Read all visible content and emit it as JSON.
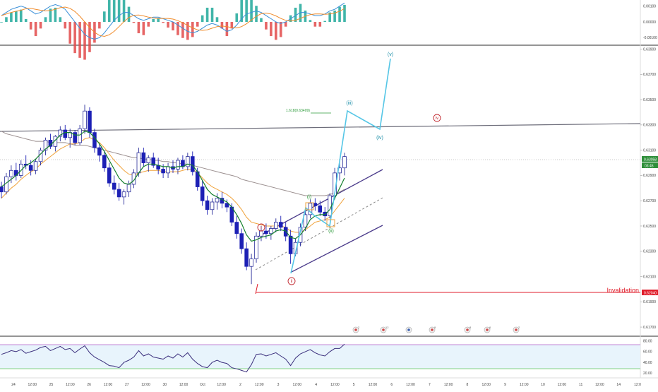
{
  "colors": {
    "up": "#2a2e9a",
    "down": "#1d20b5",
    "ema_fast": "#16802e",
    "ema_slow": "#f0a33c",
    "sma_long": "#9b8f8f",
    "wave": "#55c6e6",
    "channel": "#4a3a8a",
    "invalidation": "#e01e2b",
    "fib_label": "#2c9a3a",
    "wave_red": "#c0262d",
    "wave_green": "#2c9a3a",
    "wave_teal": "#1d8fa8",
    "rsi": "#3b2f7d",
    "rsi_band_fill": "#e8f4fc",
    "rsi_upper": "#b05cc6",
    "rsi_lower": "#5cc65c",
    "macd": "#3a8fd8",
    "macd_signal": "#f08c2c",
    "hist_pos": "#20a89a",
    "hist_neg": "#e24a4a",
    "axis_text": "#444444"
  },
  "price_axis": {
    "ticks": [
      "0.63900",
      "0.63700",
      "0.63500",
      "0.63300",
      "0.63100",
      "0.62900",
      "0.62700",
      "0.62500",
      "0.62300",
      "0.62100",
      "0.61900",
      "0.61700"
    ],
    "last_price_label": "0.63058",
    "countdown_label": "03:45",
    "invalidation_price_label": "0.62040"
  },
  "macd_axis": {
    "ticks": [
      "0.00100",
      "0.00000",
      "-0.00100"
    ]
  },
  "rsi_axis": {
    "ticks": [
      "80.00",
      "60.00",
      "40.00",
      "20.00"
    ]
  },
  "time_axis": {
    "labels": [
      "24",
      "12:00",
      "25",
      "12:00",
      "26",
      "12:00",
      "27",
      "12:00",
      "30",
      "12:00",
      "Oct",
      "12:00",
      "2",
      "12:00",
      "3",
      "12:00",
      "4",
      "12:00",
      "5",
      "12:00",
      "6",
      "12:00",
      "7",
      "12:00",
      "8",
      "12:00",
      "9",
      "12:00",
      "10",
      "12:00",
      "11",
      "12:00",
      "14",
      "12:0"
    ]
  },
  "annotations": {
    "fib_label": "1.618(0.63409)",
    "invalidation": "Invalidation",
    "wave_i": "i",
    "wave_ii": "ii",
    "wave_iv_big": "iv",
    "sub_i": "(i)",
    "sub_ii": "(ii)",
    "sub_iii": "(iii)",
    "sub_iv": "(iv)",
    "sub_v": "(v)"
  },
  "event_markers": [
    {
      "label": "2"
    },
    {
      "label": "12"
    },
    {
      "label": ""
    },
    {
      "label": "9"
    },
    {
      "label": "8"
    },
    {
      "label": "6"
    },
    {
      "label": "2"
    }
  ],
  "chart_data": {
    "type": "candlestick",
    "ylim": [
      0.6165,
      0.6392
    ],
    "ohlc": [
      [
        0.6281,
        0.6285,
        0.6272,
        0.6277
      ],
      [
        0.6277,
        0.6292,
        0.6275,
        0.6289
      ],
      [
        0.6289,
        0.6298,
        0.6284,
        0.6294
      ],
      [
        0.6294,
        0.63,
        0.6286,
        0.629
      ],
      [
        0.629,
        0.6302,
        0.6288,
        0.6299
      ],
      [
        0.6299,
        0.6306,
        0.6295,
        0.6298
      ],
      [
        0.6298,
        0.6302,
        0.629,
        0.6294
      ],
      [
        0.6294,
        0.6303,
        0.6291,
        0.6301
      ],
      [
        0.6301,
        0.6312,
        0.6298,
        0.631
      ],
      [
        0.631,
        0.632,
        0.6306,
        0.6318
      ],
      [
        0.6318,
        0.6323,
        0.6311,
        0.6313
      ],
      [
        0.6313,
        0.6322,
        0.6309,
        0.6321
      ],
      [
        0.6321,
        0.6329,
        0.6317,
        0.6326
      ],
      [
        0.6326,
        0.633,
        0.6318,
        0.632
      ],
      [
        0.632,
        0.6327,
        0.6312,
        0.6324
      ],
      [
        0.6324,
        0.6326,
        0.6314,
        0.6316
      ],
      [
        0.6316,
        0.633,
        0.6314,
        0.6327
      ],
      [
        0.6327,
        0.6346,
        0.6323,
        0.6341
      ],
      [
        0.6341,
        0.6344,
        0.632,
        0.6324
      ],
      [
        0.6324,
        0.6327,
        0.6308,
        0.6312
      ],
      [
        0.6312,
        0.6315,
        0.6301,
        0.6306
      ],
      [
        0.6306,
        0.6309,
        0.6293,
        0.6296
      ],
      [
        0.6296,
        0.63,
        0.6281,
        0.6284
      ],
      [
        0.6284,
        0.629,
        0.6275,
        0.6279
      ],
      [
        0.6279,
        0.6284,
        0.627,
        0.6273
      ],
      [
        0.6273,
        0.6279,
        0.6267,
        0.6277
      ],
      [
        0.6277,
        0.6286,
        0.6273,
        0.6283
      ],
      [
        0.6283,
        0.6295,
        0.628,
        0.6292
      ],
      [
        0.6292,
        0.6312,
        0.6289,
        0.6308
      ],
      [
        0.6308,
        0.6312,
        0.6297,
        0.63
      ],
      [
        0.63,
        0.6306,
        0.6293,
        0.6304
      ],
      [
        0.6304,
        0.6308,
        0.6296,
        0.6298
      ],
      [
        0.6298,
        0.6304,
        0.6291,
        0.6295
      ],
      [
        0.6295,
        0.6299,
        0.6288,
        0.6292
      ],
      [
        0.6292,
        0.63,
        0.6288,
        0.6297
      ],
      [
        0.6297,
        0.6302,
        0.6292,
        0.6295
      ],
      [
        0.6295,
        0.6304,
        0.6291,
        0.6302
      ],
      [
        0.6302,
        0.6306,
        0.6295,
        0.6297
      ],
      [
        0.6297,
        0.6308,
        0.6294,
        0.6305
      ],
      [
        0.6305,
        0.6309,
        0.629,
        0.6293
      ],
      [
        0.6293,
        0.6296,
        0.6278,
        0.6281
      ],
      [
        0.6281,
        0.6286,
        0.6266,
        0.627
      ],
      [
        0.627,
        0.6274,
        0.6259,
        0.6263
      ],
      [
        0.6263,
        0.6272,
        0.6259,
        0.6269
      ],
      [
        0.6269,
        0.6276,
        0.6263,
        0.6272
      ],
      [
        0.6272,
        0.6277,
        0.6264,
        0.6268
      ],
      [
        0.6268,
        0.6271,
        0.6261,
        0.6265
      ],
      [
        0.6265,
        0.6268,
        0.625,
        0.6253
      ],
      [
        0.6253,
        0.6258,
        0.624,
        0.6244
      ],
      [
        0.6244,
        0.6248,
        0.6228,
        0.6232
      ],
      [
        0.6232,
        0.6237,
        0.6215,
        0.6218
      ],
      [
        0.6218,
        0.6228,
        0.6204,
        0.6224
      ],
      [
        0.6224,
        0.6245,
        0.6221,
        0.6242
      ],
      [
        0.6242,
        0.625,
        0.6238,
        0.6246
      ],
      [
        0.6246,
        0.6252,
        0.624,
        0.6244
      ],
      [
        0.6244,
        0.625,
        0.6239,
        0.6248
      ],
      [
        0.6248,
        0.6256,
        0.6245,
        0.6253
      ],
      [
        0.6253,
        0.6258,
        0.6246,
        0.6249
      ],
      [
        0.6249,
        0.6253,
        0.6238,
        0.6242
      ],
      [
        0.6242,
        0.6247,
        0.622,
        0.6228
      ],
      [
        0.6228,
        0.624,
        0.6226,
        0.6237
      ],
      [
        0.6237,
        0.6252,
        0.6234,
        0.6249
      ],
      [
        0.6249,
        0.6262,
        0.6246,
        0.6259
      ],
      [
        0.6259,
        0.6271,
        0.6256,
        0.6268
      ],
      [
        0.6268,
        0.6272,
        0.6262,
        0.6266
      ],
      [
        0.6266,
        0.627,
        0.6258,
        0.6261
      ],
      [
        0.6261,
        0.6265,
        0.6254,
        0.6258
      ],
      [
        0.6258,
        0.6276,
        0.6256,
        0.6274
      ],
      [
        0.6274,
        0.6296,
        0.6271,
        0.6292
      ],
      [
        0.6292,
        0.63,
        0.6286,
        0.6296
      ],
      [
        0.6296,
        0.6308,
        0.629,
        0.6305
      ]
    ],
    "ema_fast": [
      0.6281,
      0.6284,
      0.6287,
      0.629,
      0.6294,
      0.6298,
      0.63,
      0.6303,
      0.6307,
      0.6311,
      0.6314,
      0.6318,
      0.6322,
      0.6324,
      0.6324,
      0.6322,
      0.6322,
      0.6325,
      0.6324,
      0.632,
      0.6315,
      0.6309,
      0.6302,
      0.6295,
      0.6288,
      0.6284,
      0.6283,
      0.6286,
      0.6292,
      0.6297,
      0.6299,
      0.6299,
      0.6298,
      0.6297,
      0.6297,
      0.6296,
      0.6297,
      0.6297,
      0.6299,
      0.6298,
      0.6293,
      0.6286,
      0.6279,
      0.6275,
      0.6273,
      0.6271,
      0.6269,
      0.6265,
      0.6259,
      0.6252,
      0.6243,
      0.6238,
      0.6239,
      0.6241,
      0.6242,
      0.6243,
      0.6246,
      0.6247,
      0.6246,
      0.6241,
      0.624,
      0.6243,
      0.6248,
      0.6255,
      0.6258,
      0.6259,
      0.6259,
      0.6263,
      0.6272,
      0.628,
      0.6288
    ],
    "ema_slow": [
      0.6272,
      0.6276,
      0.628,
      0.6283,
      0.6287,
      0.629,
      0.6293,
      0.6295,
      0.6299,
      0.6302,
      0.6305,
      0.6308,
      0.6311,
      0.6313,
      0.6315,
      0.6315,
      0.6316,
      0.6319,
      0.632,
      0.6318,
      0.6316,
      0.6312,
      0.6307,
      0.6302,
      0.6298,
      0.6294,
      0.6291,
      0.629,
      0.6292,
      0.6293,
      0.6294,
      0.6294,
      0.6294,
      0.6293,
      0.6293,
      0.6293,
      0.6293,
      0.6294,
      0.6295,
      0.6295,
      0.6292,
      0.6288,
      0.6284,
      0.6281,
      0.6279,
      0.6277,
      0.6275,
      0.6272,
      0.6268,
      0.6263,
      0.6257,
      0.6253,
      0.6252,
      0.6251,
      0.625,
      0.625,
      0.625,
      0.625,
      0.6249,
      0.6246,
      0.6245,
      0.6245,
      0.6247,
      0.625,
      0.6253,
      0.6254,
      0.6255,
      0.6257,
      0.6262,
      0.6267,
      0.6272
    ],
    "sma_long": [
      0.6325,
      0.6323,
      0.6322,
      0.6321,
      0.632,
      0.6319,
      0.6318,
      0.6317,
      0.6317,
      0.6317,
      0.6316,
      0.6316,
      0.6316,
      0.6316,
      0.6315,
      0.6314,
      0.6314,
      0.6314,
      0.6313,
      0.6312,
      0.6311,
      0.631,
      0.6309,
      0.6308,
      0.6307,
      0.6306,
      0.6305,
      0.6304,
      0.6304,
      0.6303,
      0.6303,
      0.6302,
      0.6302,
      0.6301,
      0.6301,
      0.63,
      0.63,
      0.6299,
      0.6299,
      0.6298,
      0.6297,
      0.6296,
      0.6295,
      0.6294,
      0.6293,
      0.6292,
      0.6291,
      0.629,
      0.6289,
      0.6287,
      0.6286,
      0.6285,
      0.6284,
      0.6283,
      0.6282,
      0.6281,
      0.628,
      0.6279,
      0.6278,
      0.6277,
      0.6276,
      0.6275,
      0.6274,
      0.6274,
      0.6274,
      0.6274,
      0.6274,
      0.6275,
      0.6276,
      0.6277,
      0.6279
    ],
    "rsi": [
      55,
      58,
      62,
      60,
      64,
      57,
      60,
      63,
      68,
      70,
      62,
      66,
      70,
      64,
      66,
      58,
      65,
      71,
      58,
      50,
      45,
      40,
      34,
      33,
      30,
      40,
      44,
      50,
      62,
      52,
      56,
      50,
      48,
      46,
      52,
      48,
      56,
      50,
      58,
      46,
      38,
      32,
      30,
      40,
      44,
      40,
      38,
      30,
      28,
      25,
      22,
      36,
      55,
      56,
      52,
      55,
      58,
      52,
      46,
      34,
      48,
      56,
      60,
      64,
      58,
      54,
      52,
      60,
      66,
      66,
      74
    ],
    "macd": [
      0.0004,
      0.0006,
      0.0008,
      0.0009,
      0.001,
      0.0009,
      0.0007,
      0.0005,
      0.0006,
      0.0008,
      0.001,
      0.0011,
      0.001,
      0.0008,
      0.0004,
      0.0,
      -0.0004,
      -0.0008,
      -0.001,
      -0.0011,
      -0.001,
      -0.0007,
      -0.0003,
      0.0001,
      0.0004,
      0.0006,
      0.0006,
      0.0004,
      0.0002,
      0.0001,
      0.0002,
      0.0003,
      0.0003,
      0.0002,
      0.0001,
      0.0,
      -0.0002,
      -0.0004,
      -0.0006,
      -0.0007,
      -0.0006,
      -0.0004,
      -0.0002,
      -0.0001,
      -0.0002,
      -0.0004,
      -0.0006,
      -0.0005,
      -0.0002,
      0.0002,
      0.0005,
      0.0006,
      0.0007,
      0.0006,
      0.0004,
      0.0002,
      0.0,
      -0.0001,
      0.0,
      0.0002,
      0.0004,
      0.0006,
      0.0006,
      0.0005,
      0.0004,
      0.0004,
      0.0005,
      0.0007,
      0.0008,
      0.001,
      0.0012
    ]
  }
}
